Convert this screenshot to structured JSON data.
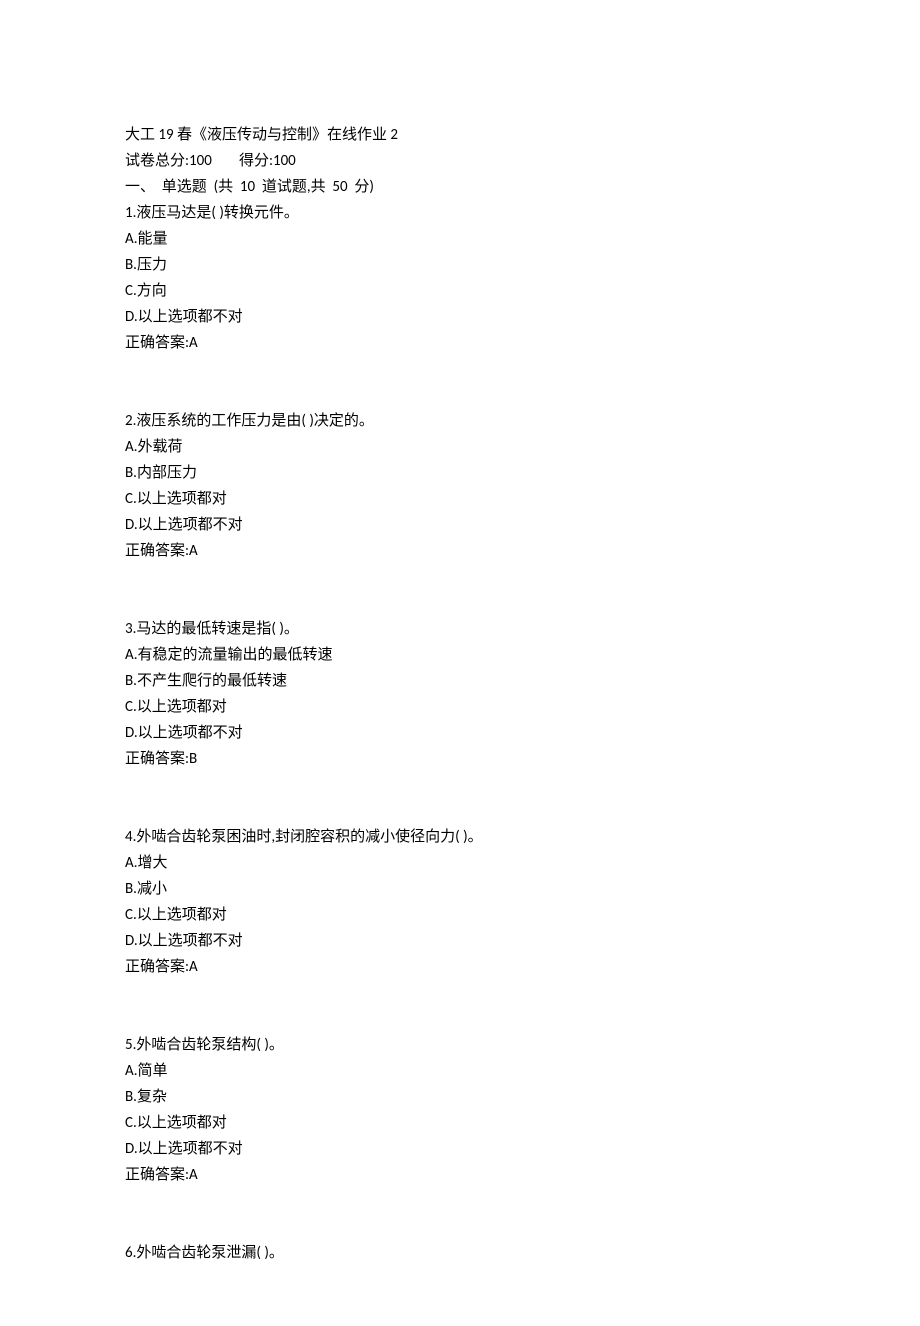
{
  "header": {
    "title": "大工 19 春《液压传动与控制》在线作业 2",
    "totalScoreLabel": "试卷总分:100        得分:100",
    "sectionHeader": "一、  单选题  (共  10  道试题,共  50  分)"
  },
  "questions": [
    {
      "num": "1",
      "stem": "液压马达是( )转换元件。",
      "options": [
        "A.能量",
        "B.压力",
        "C.方向",
        "D.以上选项都不对"
      ],
      "answer": "正确答案:A"
    },
    {
      "num": "2",
      "stem": "液压系统的工作压力是由( )决定的。",
      "options": [
        "A.外载荷",
        "B.内部压力",
        "C.以上选项都对",
        "D.以上选项都不对"
      ],
      "answer": "正确答案:A"
    },
    {
      "num": "3",
      "stem": "马达的最低转速是指( )。",
      "options": [
        "A.有稳定的流量输出的最低转速",
        "B.不产生爬行的最低转速",
        "C.以上选项都对",
        "D.以上选项都不对"
      ],
      "answer": "正确答案:B"
    },
    {
      "num": "4",
      "stem": "外啮合齿轮泵困油时,封闭腔容积的减小使径向力( )。",
      "options": [
        "A.增大",
        "B.减小",
        "C.以上选项都对",
        "D.以上选项都不对"
      ],
      "answer": "正确答案:A"
    },
    {
      "num": "5",
      "stem": "外啮合齿轮泵结构( )。",
      "options": [
        "A.简单",
        "B.复杂",
        "C.以上选项都对",
        "D.以上选项都不对"
      ],
      "answer": "正确答案:A"
    },
    {
      "num": "6",
      "stem": "外啮合齿轮泵泄漏( )。",
      "options": [],
      "answer": ""
    }
  ]
}
